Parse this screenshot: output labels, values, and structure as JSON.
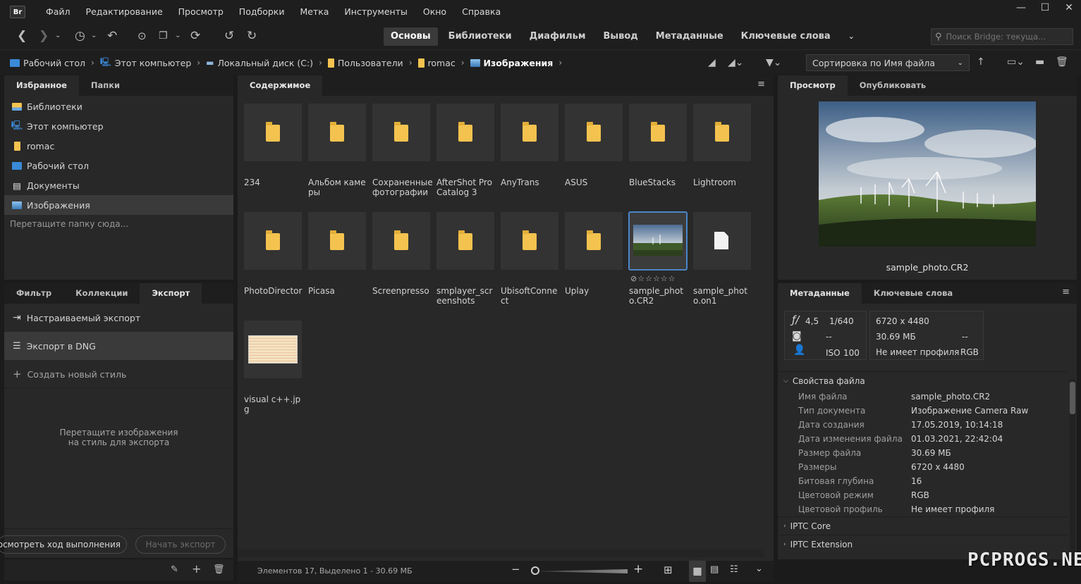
{
  "app": {
    "logo_text": "Br"
  },
  "menu": [
    "Файл",
    "Редактирование",
    "Просмотр",
    "Подборки",
    "Метка",
    "Инструменты",
    "Окно",
    "Справка"
  ],
  "window_controls": {
    "minimize": "—",
    "maximize": "☐",
    "close": "✕"
  },
  "workspaces": [
    {
      "label": "Основы",
      "active": true
    },
    {
      "label": "Библиотеки",
      "active": false
    },
    {
      "label": "Диафильм",
      "active": false
    },
    {
      "label": "Вывод",
      "active": false
    },
    {
      "label": "Метаданные",
      "active": false
    },
    {
      "label": "Ключевые слова",
      "active": false
    }
  ],
  "search": {
    "placeholder": "Поиск Bridge: текуща..."
  },
  "breadcrumb": [
    {
      "label": "Рабочий стол",
      "icon": "monitor-icon"
    },
    {
      "label": "Этот компьютер",
      "icon": "computer-icon"
    },
    {
      "label": "Локальный диск (C:)",
      "icon": "drive-icon"
    },
    {
      "label": "Пользователи",
      "icon": "folder-icon"
    },
    {
      "label": "romac",
      "icon": "folder-icon"
    },
    {
      "label": "Изображения",
      "icon": "pictures-icon"
    }
  ],
  "sort": {
    "label": "Сортировка по Имя файла"
  },
  "left_top": {
    "tabs": [
      "Избранное",
      "Папки"
    ],
    "favorites": [
      {
        "label": "Библиотеки",
        "icon": "libraries-icon"
      },
      {
        "label": "Этот компьютер",
        "icon": "computer-icon"
      },
      {
        "label": "romac",
        "icon": "folder-icon"
      },
      {
        "label": "Рабочий стол",
        "icon": "desktop-icon"
      },
      {
        "label": "Документы",
        "icon": "documents-icon"
      },
      {
        "label": "Изображения",
        "icon": "pictures-icon"
      }
    ],
    "drop_hint": "Перетащите папку сюда..."
  },
  "left_bottom": {
    "tabs": [
      "Фильтр",
      "Коллекции",
      "Экспорт"
    ],
    "custom_export": "Настраиваемый экспорт",
    "export_dng": "Экспорт в DNG",
    "new_style": "Создать новый стиль",
    "drop_hint_1": "Перетащите изображения",
    "drop_hint_2": "на стиль для экспорта",
    "progress_btn": "осмотреть ход выполнения",
    "start_btn": "Начать экспорт"
  },
  "content": {
    "tab": "Содержимое",
    "items": [
      {
        "name": "234",
        "type": "folder"
      },
      {
        "name": "Альбом камеры",
        "type": "folder"
      },
      {
        "name": "Сохраненные фотографии",
        "type": "folder"
      },
      {
        "name": "AfterShot Pro Catalog 3",
        "type": "folder"
      },
      {
        "name": "AnyTrans",
        "type": "folder"
      },
      {
        "name": "ASUS",
        "type": "folder"
      },
      {
        "name": "BlueStacks",
        "type": "folder"
      },
      {
        "name": "Lightroom",
        "type": "folder"
      },
      {
        "name": "PhotoDirector",
        "type": "folder"
      },
      {
        "name": "Picasa",
        "type": "folder"
      },
      {
        "name": "Screenpresso",
        "type": "folder"
      },
      {
        "name": "smplayer_screenshots",
        "type": "folder"
      },
      {
        "name": "UbisoftConnect",
        "type": "folder"
      },
      {
        "name": "Uplay",
        "type": "folder"
      },
      {
        "name": "sample_photo.CR2",
        "type": "photo",
        "selected": true,
        "rating": "⊘☆☆☆☆☆"
      },
      {
        "name": "sample_photo.on1",
        "type": "file"
      },
      {
        "name": "visual c++.jpg",
        "type": "image"
      }
    ],
    "status": "Элементов 17, Выделено 1 - 30.69 МБ"
  },
  "preview": {
    "tabs": [
      "Просмотр",
      "Опубликовать"
    ],
    "caption": "sample_photo.CR2"
  },
  "metadata": {
    "tabs": [
      "Метаданные",
      "Ключевые слова"
    ],
    "aperture": "4,5",
    "shutter": "1/640",
    "dash1": "--",
    "iso_label": "ISO",
    "iso": "100",
    "dimensions": "6720 x 4480",
    "size": "30.69 МБ",
    "dash2": "--",
    "profile": "Не имеет профиля",
    "mode": "RGB",
    "section_file": "Свойства файла",
    "rows": [
      {
        "label": "Имя файла",
        "value": "sample_photo.CR2"
      },
      {
        "label": "Тип документа",
        "value": "Изображение Camera Raw"
      },
      {
        "label": "Дата создания",
        "value": "17.05.2019, 10:14:18"
      },
      {
        "label": "Дата изменения файла",
        "value": "01.03.2021, 22:42:04"
      },
      {
        "label": "Размер файла",
        "value": "30.69 МБ"
      },
      {
        "label": "Размеры",
        "value": "6720 x 4480"
      },
      {
        "label": "Битовая глубина",
        "value": "16"
      },
      {
        "label": "Цветовой режим",
        "value": "RGB"
      },
      {
        "label": "Цветовой профиль",
        "value": "Не имеет профиля"
      }
    ],
    "section_iptc_core": "IPTC Core",
    "section_iptc_ext": "IPTC Extension"
  },
  "watermark": "PCPROGS.NET",
  "colors": {
    "accent": "#4a86c8",
    "folder": "#f4c34f",
    "background": "#282828"
  }
}
